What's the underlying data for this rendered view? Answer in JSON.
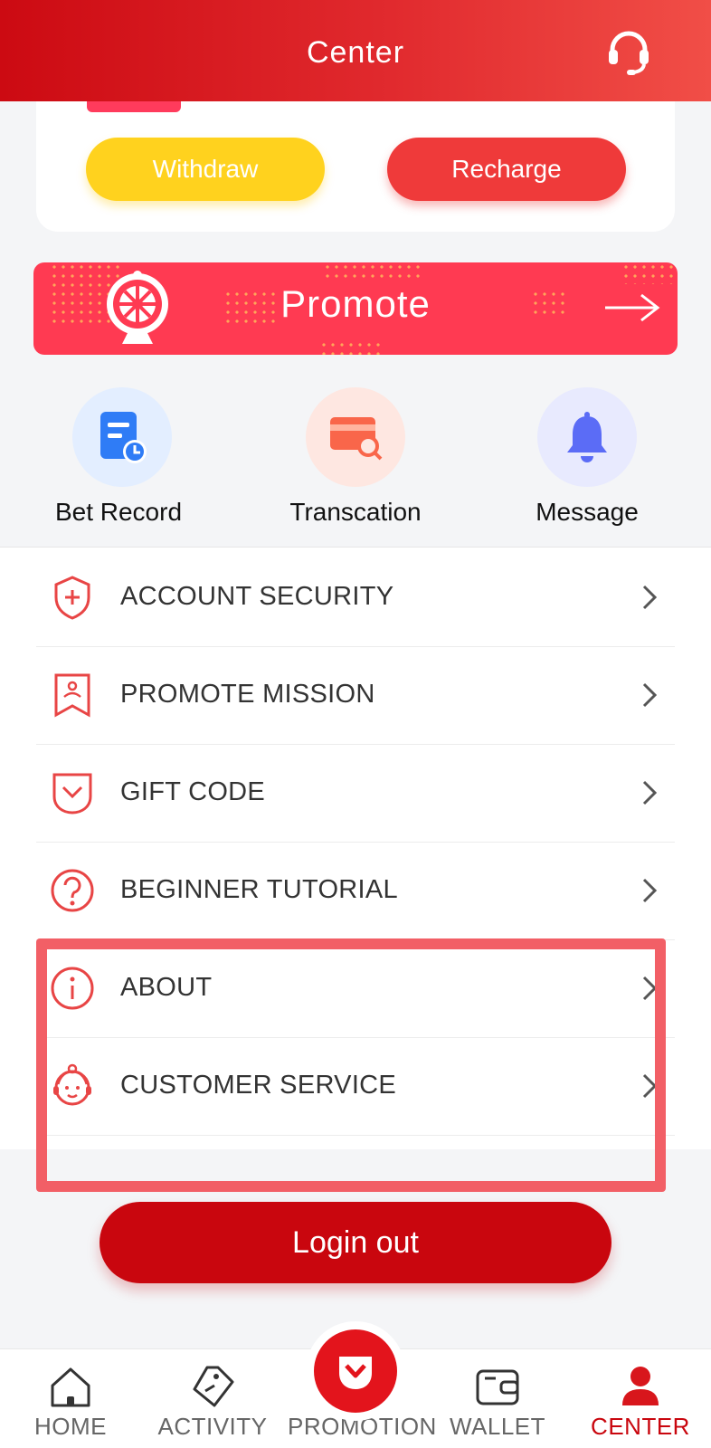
{
  "header": {
    "title": "Center",
    "support_icon": "headset-icon"
  },
  "wallet": {
    "withdraw_label": "Withdraw",
    "recharge_label": "Recharge"
  },
  "promote": {
    "label": "Promote"
  },
  "quick_actions": [
    {
      "label": "Bet Record",
      "icon": "bet-record-icon",
      "bg": "#e3eeff"
    },
    {
      "label": "Transcation",
      "icon": "transaction-card-icon",
      "bg": "#fee7e1"
    },
    {
      "label": "Message",
      "icon": "bell-icon",
      "bg": "#e8eafe"
    }
  ],
  "menu": [
    {
      "label": "ACCOUNT SECURITY",
      "icon": "shield-plus-icon"
    },
    {
      "label": "PROMOTE MISSION",
      "icon": "mission-badge-icon"
    },
    {
      "label": "GIFT CODE",
      "icon": "gift-code-icon"
    },
    {
      "label": "BEGINNER TUTORIAL",
      "icon": "question-circle-icon"
    },
    {
      "label": "ABOUT",
      "icon": "info-circle-icon"
    },
    {
      "label": "CUSTOMER SERVICE",
      "icon": "customer-service-icon"
    }
  ],
  "logout_label": "Login out",
  "nav": [
    {
      "label": "HOME",
      "icon": "home-icon",
      "active": false
    },
    {
      "label": "ACTIVITY",
      "icon": "tag-icon",
      "active": false
    },
    {
      "label": "PROMOTION",
      "icon": "promotion-icon",
      "active": false
    },
    {
      "label": "WALLET",
      "icon": "wallet-icon",
      "active": false
    },
    {
      "label": "CENTER",
      "icon": "user-icon",
      "active": true
    }
  ],
  "colors": {
    "brand_red": "#c9060e",
    "accent_yellow": "#ffd21e",
    "promote_red": "#ff3a52"
  }
}
